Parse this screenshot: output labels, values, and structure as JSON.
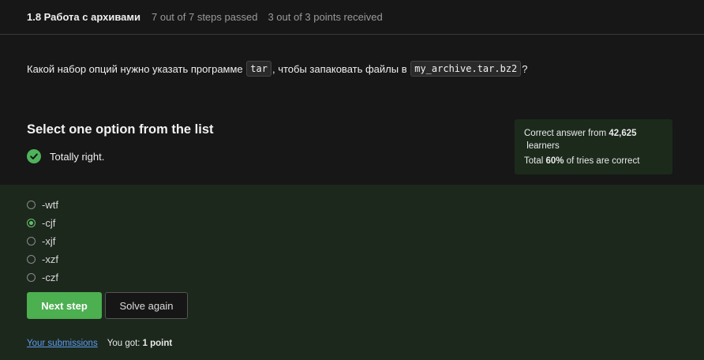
{
  "header": {
    "lesson_title": "1.8 Работа с архивами",
    "steps_passed": "7 out of 7 steps passed",
    "points_received": "3 out of 3 points  received"
  },
  "question": {
    "text_before": "Какой набор опций нужно указать программе ",
    "code_program": "tar",
    "text_middle": ", чтобы запаковать файлы в ",
    "code_archive": "my_archive.tar.bz2",
    "text_after": "?"
  },
  "quiz": {
    "heading": "Select one option from the list",
    "status_text": "Totally right.",
    "status_icon": "check-circle-icon",
    "accent_color": "#4caf50"
  },
  "stats": {
    "line1_prefix": "Correct answer from ",
    "learners_count": "42,625",
    "line1_suffix": " learners",
    "line2_prefix": "Total ",
    "percent": "60%",
    "line2_suffix": " of tries are correct"
  },
  "options": [
    {
      "label": "-wtf",
      "selected": false
    },
    {
      "label": "-cjf",
      "selected": true
    },
    {
      "label": "-xjf",
      "selected": false
    },
    {
      "label": "-xzf",
      "selected": false
    },
    {
      "label": "-czf",
      "selected": false
    }
  ],
  "actions": {
    "next_label": "Next step",
    "solve_again_label": "Solve again"
  },
  "footer": {
    "submissions_link": "Your submissions",
    "got_prefix": "You got:",
    "got_value": "1 point"
  }
}
